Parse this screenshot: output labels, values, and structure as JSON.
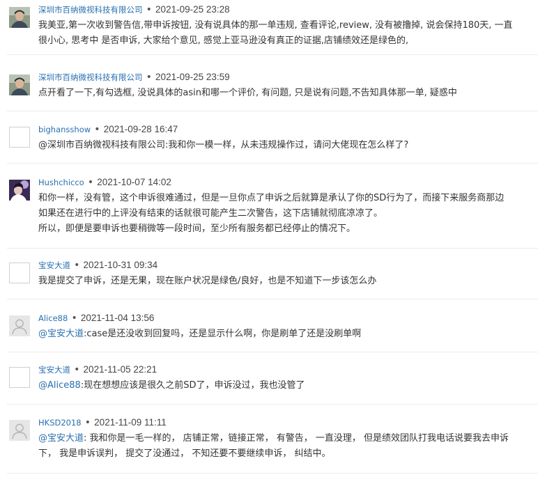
{
  "comments": [
    {
      "author": "深圳市百纳微视科技有限公司",
      "separator": "•",
      "date": "2021-09-25 23:28",
      "avatar": "photo-man-icon",
      "lines": [
        "我美亚,第一次收到警告信,带申诉按钮, 没有说具体的那一单违规, 查看评论,review, 没有被撸掉, 说会保持180天, 一直",
        "很小心, 思考中 是否申诉, 大家给个意见, 感觉上亚马逊没有真正的证据,店铺绩效还是绿色的,"
      ]
    },
    {
      "author": "深圳市百纳微视科技有限公司",
      "separator": "•",
      "date": "2021-09-25 23:59",
      "avatar": "photo-man-icon",
      "lines": [
        "点开看了一下,有勾选框, 没说具体的asin和哪一个评价, 有问题, 只是说有问题,不告知具体那一单, 疑惑中"
      ]
    },
    {
      "author": "bighansshow",
      "separator": "•",
      "date": "2021-09-28 16:47",
      "avatar": "blank-avatar-icon",
      "lines": [
        "@深圳市百纳微视科技有限公司:我和你一模一样，从未违规操作过，请问大佬现在怎么样了?"
      ]
    },
    {
      "author": "Hushchicco",
      "separator": "•",
      "date": "2021-10-07 14:02",
      "avatar": "photo-purple-icon",
      "lines": [
        "和你一样，没有管，这个申诉很难通过，但是一旦你点了申诉之后就算是承认了你的SD行为了，而接下来服务商那边",
        "如果还在进行中的上评没有结束的话就很可能产生二次警告，这下店铺就彻底凉凉了。",
        "所以，即便是要申诉也要稍微等一段时间，至少所有服务都已经停止的情况下。"
      ]
    },
    {
      "author": "宝安大道",
      "separator": "•",
      "date": "2021-10-31 09:34",
      "avatar": "blank-avatar-icon",
      "lines": [
        "我是提交了申诉，还是无果，现在账户状况是绿色/良好，也是不知道下一步该怎么办"
      ]
    },
    {
      "author": "Alice88",
      "separator": "•",
      "date": "2021-11-04 13:56",
      "avatar": "default-user-icon",
      "mention": "@宝安大道",
      "lines": [
        ":case是还没收到回复吗，还是显示什么啊，你是刷单了还是没刷单啊"
      ]
    },
    {
      "author": "宝安大道",
      "separator": "•",
      "date": "2021-11-05 22:21",
      "avatar": "blank-avatar-icon",
      "mention": "@Alice88",
      "lines": [
        ":现在想想应该是很久之前SD了，申诉没过，我也没管了"
      ]
    },
    {
      "author": "HKSD2018",
      "separator": "•",
      "date": "2021-11-09 11:11",
      "avatar": "default-user-icon",
      "mention": "@宝安大道",
      "lines": [
        ": 我和你是一毛一样的，   店铺正常，链接正常，   有警告，   一直没理，   但是绩效团队打我电话说要我去申诉",
        "下，   我是申诉误判，   提交了没通过，   不知还要不要继续申诉，   纠结中。"
      ]
    }
  ]
}
